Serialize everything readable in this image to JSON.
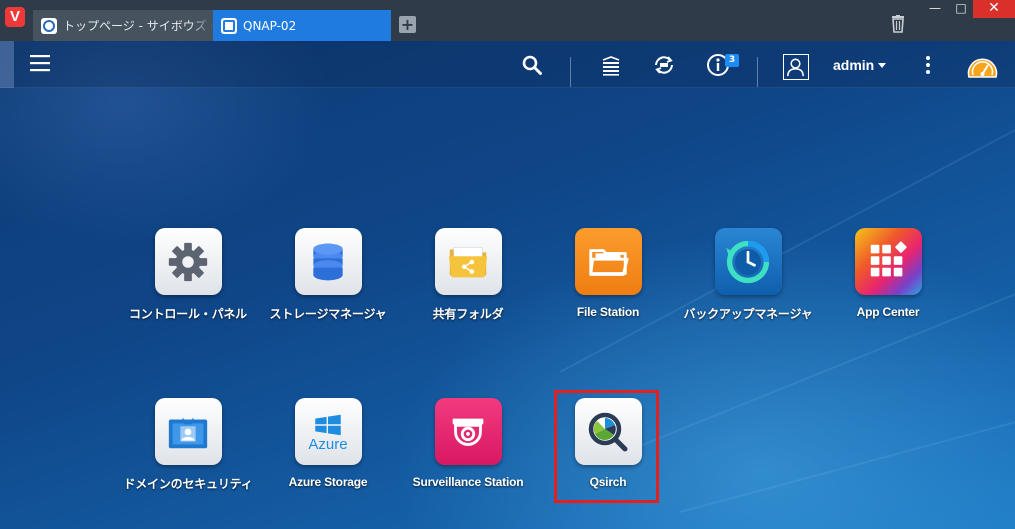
{
  "browser": {
    "tabs": [
      {
        "title": "トップページ - サイボウズ Of",
        "active": false
      },
      {
        "title": "QNAP-02",
        "active": true
      }
    ],
    "logo": "V"
  },
  "topbar": {
    "username": "admin",
    "notification_count": "3",
    "icons": [
      "menu-icon",
      "search-icon",
      "storage-icon",
      "sync-icon",
      "info-icon",
      "user-icon",
      "more-icon",
      "dashboard-gauge-icon"
    ]
  },
  "apps": [
    {
      "label": "コントロール・パネル",
      "icon": "gear-icon"
    },
    {
      "label": "ストレージマネージャ",
      "icon": "database-icon"
    },
    {
      "label": "共有フォルダ",
      "icon": "shared-folder-icon"
    },
    {
      "label": "File Station",
      "icon": "folder-icon"
    },
    {
      "label": "バックアップマネージャ",
      "icon": "backup-clock-icon"
    },
    {
      "label": "App Center",
      "icon": "app-grid-icon"
    },
    {
      "label": "ドメインのセキュリティ",
      "icon": "id-card-icon"
    },
    {
      "label": "Azure Storage",
      "icon": "azure-icon"
    },
    {
      "label": "Surveillance Station",
      "icon": "camera-icon"
    },
    {
      "label": "Qsirch",
      "icon": "qsirch-search-icon"
    }
  ],
  "colors": {
    "active_tab": "#1f7be0",
    "highlight": "#e3201e",
    "file_station": "#f68b1f",
    "surveillance": "#e9246f"
  }
}
